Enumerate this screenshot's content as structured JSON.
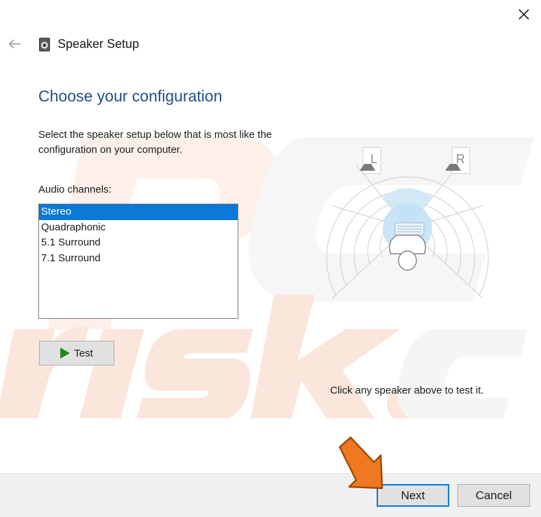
{
  "window": {
    "title": "Speaker Setup"
  },
  "page": {
    "heading": "Choose your configuration",
    "instructions": "Select the speaker setup below that is most like the configuration on your computer.",
    "channels_label": "Audio channels:",
    "hint": "Click any speaker above to test it."
  },
  "channels": {
    "items": [
      {
        "label": "Stereo",
        "selected": true
      },
      {
        "label": "Quadraphonic",
        "selected": false
      },
      {
        "label": "5.1 Surround",
        "selected": false
      },
      {
        "label": "7.1 Surround",
        "selected": false
      }
    ]
  },
  "diagram": {
    "left_speaker_label": "L",
    "right_speaker_label": "R"
  },
  "buttons": {
    "test_label": "Test",
    "next_label": "Next",
    "cancel_label": "Cancel"
  },
  "colors": {
    "heading": "#1f4e8c",
    "selection": "#0a79d8",
    "play_icon": "#1e8a1e",
    "pointer_arrow": "#f07820"
  }
}
